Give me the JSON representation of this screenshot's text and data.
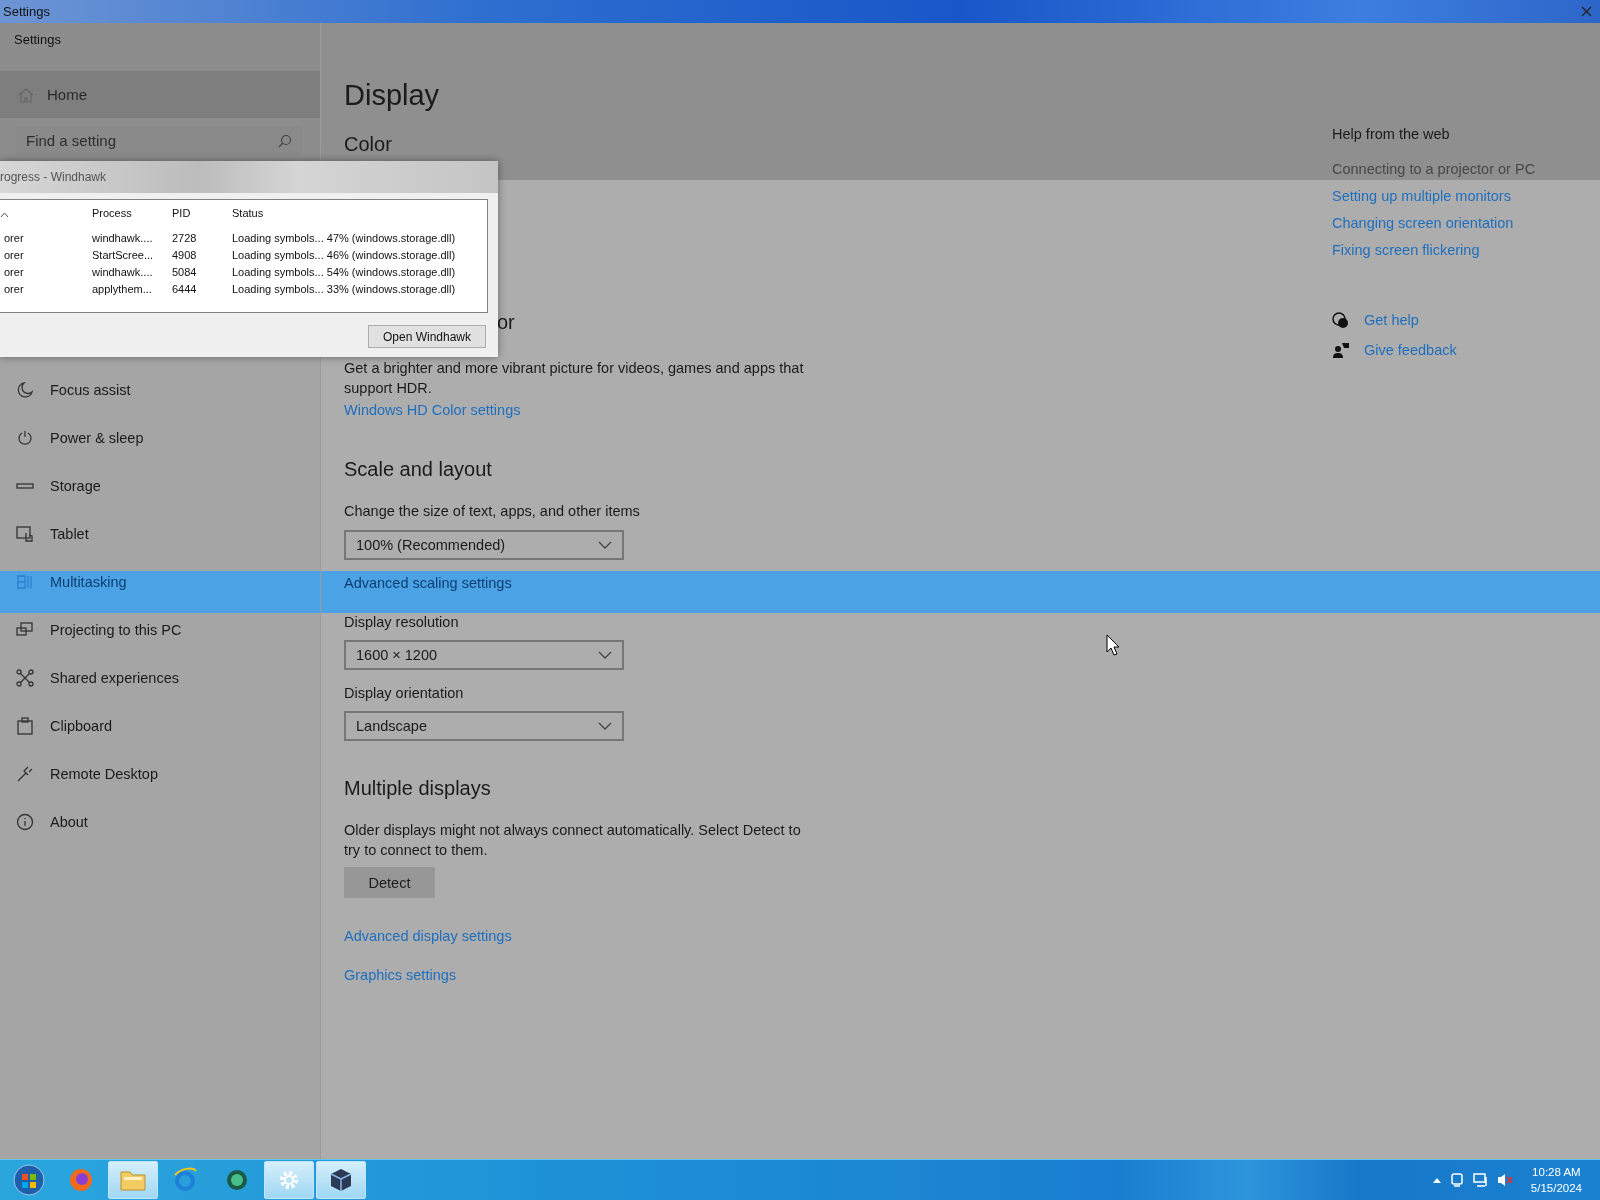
{
  "window": {
    "title": "Settings"
  },
  "app": {
    "title": "Settings"
  },
  "sidebar": {
    "home": {
      "label": "Home"
    },
    "search": {
      "placeholder": "Find a setting"
    },
    "items": [
      {
        "label": "Focus assist"
      },
      {
        "label": "Power & sleep"
      },
      {
        "label": "Storage"
      },
      {
        "label": "Tablet"
      },
      {
        "label": "Multitasking"
      },
      {
        "label": "Projecting to this PC"
      },
      {
        "label": "Shared experiences"
      },
      {
        "label": "Clipboard"
      },
      {
        "label": "Remote Desktop"
      },
      {
        "label": "About"
      }
    ]
  },
  "page": {
    "title": "Display",
    "color": {
      "heading": "Color",
      "hd_heading_fragment": "or",
      "hd_description": "Get a brighter and more vibrant picture for videos, games and apps that support HDR.",
      "hd_link": "Windows HD Color settings"
    },
    "scale": {
      "heading": "Scale and layout",
      "size_label": "Change the size of text, apps, and other items",
      "size_value": "100% (Recommended)",
      "advanced_link": "Advanced scaling settings",
      "resolution_label": "Display resolution",
      "resolution_value": "1600 × 1200",
      "orientation_label": "Display orientation",
      "orientation_value": "Landscape"
    },
    "multiple": {
      "heading": "Multiple displays",
      "description": "Older displays might not always connect automatically. Select Detect to try to connect to them.",
      "button": "Detect",
      "links": [
        "Advanced display settings",
        "Graphics settings"
      ]
    }
  },
  "help": {
    "title": "Help from the web",
    "links": [
      {
        "label": "Connecting to a projector or PC",
        "disabled": true
      },
      {
        "label": "Setting up multiple monitors",
        "disabled": false
      },
      {
        "label": "Changing screen orientation",
        "disabled": false
      },
      {
        "label": "Fixing screen flickering",
        "disabled": false
      }
    ],
    "actions": [
      {
        "label": "Get help"
      },
      {
        "label": "Give feedback"
      }
    ]
  },
  "dialog": {
    "title": "rogress - Windhawk",
    "sort_caret": true,
    "headers": [
      "Process",
      "PID",
      "Status"
    ],
    "rows": [
      {
        "column_1": "orer",
        "process": "windhawk....",
        "pid": "2728",
        "status": "Loading symbols... 47% (windows.storage.dll)"
      },
      {
        "column_1": "orer",
        "process": "StartScree...",
        "pid": "4908",
        "status": "Loading symbols... 46% (windows.storage.dll)"
      },
      {
        "column_1": "orer",
        "process": "windhawk....",
        "pid": "5084",
        "status": "Loading symbols... 54% (windows.storage.dll)"
      },
      {
        "column_1": "orer",
        "process": "applythem...",
        "pid": "6444",
        "status": "Loading symbols... 33% (windows.storage.dll)"
      }
    ],
    "button": "Open Windhawk"
  },
  "taskbar": {
    "apps": [
      {
        "active": false
      },
      {
        "active": true
      },
      {
        "active": false
      },
      {
        "active": false
      },
      {
        "active": true
      },
      {
        "active": true
      }
    ],
    "clock": {
      "time": "10:28 AM",
      "date": "5/15/2024"
    }
  }
}
